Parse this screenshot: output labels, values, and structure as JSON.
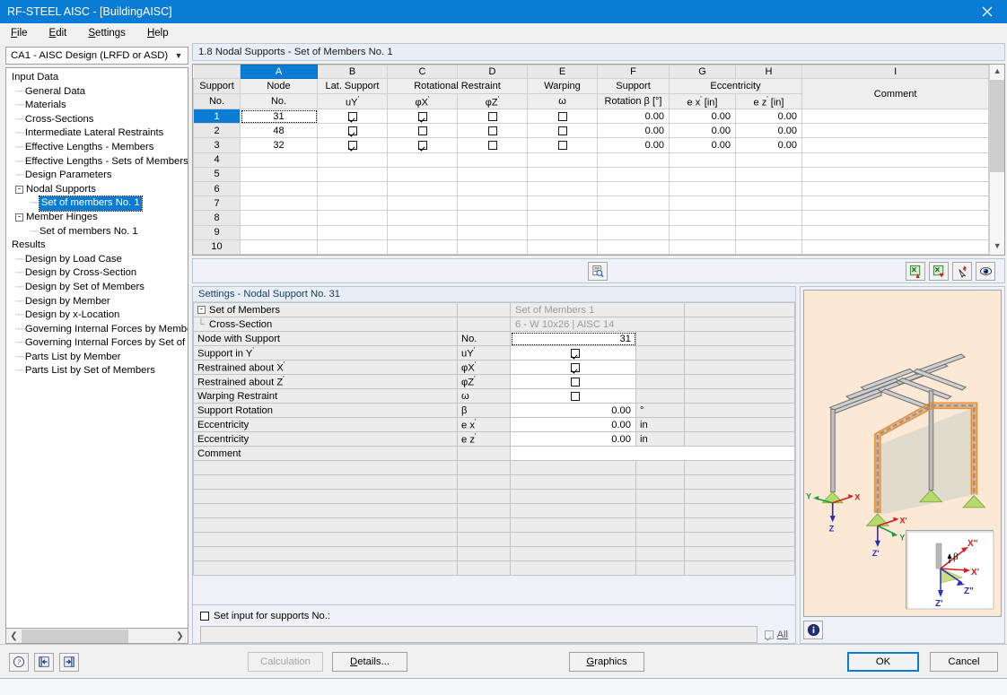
{
  "window": {
    "title": "RF-STEEL AISC - [BuildingAISC]",
    "close_icon": "close-icon"
  },
  "menu": [
    {
      "label": "File",
      "accel": "F"
    },
    {
      "label": "Edit",
      "accel": "E"
    },
    {
      "label": "Settings",
      "accel": "S"
    },
    {
      "label": "Help",
      "accel": "H"
    }
  ],
  "sidebar": {
    "combo_value": "CA1 - AISC Design (LRFD or ASD)",
    "nodes": [
      {
        "label": "Input Data",
        "level": 0,
        "expander": "",
        "selected": false
      },
      {
        "label": "General Data",
        "level": 1,
        "expander": "",
        "selected": false
      },
      {
        "label": "Materials",
        "level": 1,
        "expander": "",
        "selected": false
      },
      {
        "label": "Cross-Sections",
        "level": 1,
        "expander": "",
        "selected": false
      },
      {
        "label": "Intermediate Lateral Restraints",
        "level": 1,
        "expander": "",
        "selected": false
      },
      {
        "label": "Effective Lengths - Members",
        "level": 1,
        "expander": "",
        "selected": false
      },
      {
        "label": "Effective Lengths - Sets of Members",
        "level": 1,
        "expander": "",
        "selected": false
      },
      {
        "label": "Design Parameters",
        "level": 1,
        "expander": "",
        "selected": false
      },
      {
        "label": "Nodal Supports",
        "level": 1,
        "expander": "-",
        "selected": false
      },
      {
        "label": "Set of members No. 1",
        "level": 2,
        "expander": "",
        "selected": true
      },
      {
        "label": "Member Hinges",
        "level": 1,
        "expander": "-",
        "selected": false
      },
      {
        "label": "Set of members No. 1",
        "level": 2,
        "expander": "",
        "selected": false
      },
      {
        "label": "Results",
        "level": 0,
        "expander": "",
        "selected": false
      },
      {
        "label": "Design by Load Case",
        "level": 1,
        "expander": "",
        "selected": false
      },
      {
        "label": "Design by Cross-Section",
        "level": 1,
        "expander": "",
        "selected": false
      },
      {
        "label": "Design by Set of Members",
        "level": 1,
        "expander": "",
        "selected": false
      },
      {
        "label": "Design by Member",
        "level": 1,
        "expander": "",
        "selected": false
      },
      {
        "label": "Design by x-Location",
        "level": 1,
        "expander": "",
        "selected": false
      },
      {
        "label": "Governing Internal Forces by Member",
        "level": 1,
        "expander": "",
        "selected": false
      },
      {
        "label": "Governing Internal Forces by Set of M",
        "level": 1,
        "expander": "",
        "selected": false
      },
      {
        "label": "Parts List by Member",
        "level": 1,
        "expander": "",
        "selected": false
      },
      {
        "label": "Parts List by Set of Members",
        "level": 1,
        "expander": "",
        "selected": false
      }
    ]
  },
  "panel": {
    "title": "1.8 Nodal Supports - Set of Members No. 1"
  },
  "table": {
    "column_letters": [
      "",
      "A",
      "B",
      "C",
      "D",
      "E",
      "F",
      "G",
      "H",
      "I"
    ],
    "selected_letter": "A",
    "headers": [
      {
        "top": "Support",
        "bottom": "No.",
        "sym": ""
      },
      {
        "top": "Node",
        "bottom": "No.",
        "sym": ""
      },
      {
        "top": "Lat. Support",
        "bottom": "",
        "sym": "uY'"
      },
      {
        "top": "Rotational Restraint",
        "bottom": "",
        "sym": "φX'"
      },
      {
        "top": "",
        "bottom": "",
        "sym": "φZ'"
      },
      {
        "top": "Warping",
        "bottom": "",
        "sym": "ω"
      },
      {
        "top": "Support",
        "bottom": "Rotation β [°]",
        "sym": ""
      },
      {
        "top": "Eccentricity",
        "bottom": "e x' [in]",
        "sym": ""
      },
      {
        "top": "",
        "bottom": "e z' [in]",
        "sym": ""
      },
      {
        "top": "Comment",
        "bottom": "",
        "sym": ""
      }
    ],
    "rows": [
      {
        "no": "1",
        "node": "31",
        "lat": true,
        "rx": true,
        "rz": false,
        "warp": false,
        "beta": "0.00",
        "ex": "0.00",
        "ez": "0.00",
        "comment": "",
        "selected": true
      },
      {
        "no": "2",
        "node": "48",
        "lat": true,
        "rx": false,
        "rz": false,
        "warp": false,
        "beta": "0.00",
        "ex": "0.00",
        "ez": "0.00",
        "comment": "",
        "selected": false
      },
      {
        "no": "3",
        "node": "32",
        "lat": true,
        "rx": true,
        "rz": false,
        "warp": false,
        "beta": "0.00",
        "ex": "0.00",
        "ez": "0.00",
        "comment": "",
        "selected": false
      },
      {
        "no": "4",
        "node": "",
        "lat": null,
        "rx": null,
        "rz": null,
        "warp": null,
        "beta": "",
        "ex": "",
        "ez": "",
        "comment": "",
        "selected": false
      },
      {
        "no": "5",
        "node": "",
        "lat": null,
        "rx": null,
        "rz": null,
        "warp": null,
        "beta": "",
        "ex": "",
        "ez": "",
        "comment": "",
        "selected": false
      },
      {
        "no": "6",
        "node": "",
        "lat": null,
        "rx": null,
        "rz": null,
        "warp": null,
        "beta": "",
        "ex": "",
        "ez": "",
        "comment": "",
        "selected": false
      },
      {
        "no": "7",
        "node": "",
        "lat": null,
        "rx": null,
        "rz": null,
        "warp": null,
        "beta": "",
        "ex": "",
        "ez": "",
        "comment": "",
        "selected": false
      },
      {
        "no": "8",
        "node": "",
        "lat": null,
        "rx": null,
        "rz": null,
        "warp": null,
        "beta": "",
        "ex": "",
        "ez": "",
        "comment": "",
        "selected": false
      },
      {
        "no": "9",
        "node": "",
        "lat": null,
        "rx": null,
        "rz": null,
        "warp": null,
        "beta": "",
        "ex": "",
        "ez": "",
        "comment": "",
        "selected": false
      },
      {
        "no": "10",
        "node": "",
        "lat": null,
        "rx": null,
        "rz": null,
        "warp": null,
        "beta": "",
        "ex": "",
        "ez": "",
        "comment": "",
        "selected": false
      }
    ]
  },
  "midtoolbar": {
    "view_icon": "document-search-icon",
    "import_excel_icon": "excel-import-icon",
    "export_excel_icon": "excel-export-icon",
    "pick_icon": "pick-pointer-icon",
    "visibility_icon": "eye-icon"
  },
  "settings": {
    "title": "Settings - Nodal Support No. 31",
    "rows": [
      {
        "name": "Set of Members",
        "sym": "",
        "value": "Set of Members 1",
        "unit": "",
        "kind": "gray",
        "indent": 0,
        "expander": "-"
      },
      {
        "name": "Cross-Section",
        "sym": "",
        "value": "6 - W 10x26 | AISC 14",
        "unit": "",
        "kind": "gray",
        "indent": 1,
        "elbow": true
      },
      {
        "name": "Node with Support",
        "sym": "No.",
        "value": "31",
        "unit": "",
        "kind": "num-focus",
        "indent": 1
      },
      {
        "name": "Support in Y'",
        "sym": "uY'",
        "value": true,
        "unit": "",
        "kind": "check",
        "indent": 1
      },
      {
        "name": "Restrained about X'",
        "sym": "φX'",
        "value": true,
        "unit": "",
        "kind": "check",
        "indent": 1
      },
      {
        "name": "Restrained about Z'",
        "sym": "φZ'",
        "value": false,
        "unit": "",
        "kind": "check",
        "indent": 1
      },
      {
        "name": "Warping Restraint",
        "sym": "ω",
        "value": false,
        "unit": "",
        "kind": "check",
        "indent": 1
      },
      {
        "name": "Support Rotation",
        "sym": "β",
        "value": "0.00",
        "unit": "°",
        "kind": "num",
        "indent": 1
      },
      {
        "name": "Eccentricity",
        "sym": "e x'",
        "value": "0.00",
        "unit": "in",
        "kind": "num",
        "indent": 1
      },
      {
        "name": "Eccentricity",
        "sym": "e z'",
        "value": "0.00",
        "unit": "in",
        "kind": "num",
        "indent": 1
      },
      {
        "name": "Comment",
        "sym": "",
        "value": "",
        "unit": "",
        "kind": "text",
        "indent": 1
      }
    ],
    "empty_row_count": 8,
    "footer": {
      "set_input_label": "Set input for supports No.:",
      "set_input_checked": false,
      "input_value": "",
      "all_label": "All",
      "all_checked": true,
      "all_disabled": true
    }
  },
  "view3d": {
    "axes_global": {
      "x": "X",
      "y": "Y",
      "z": "Z"
    },
    "axes_local": {
      "x": "X'",
      "y": "Y'",
      "z": "Z'"
    },
    "inset": {
      "x2": "X\"",
      "x1": "X'",
      "z2": "Z\"",
      "z1": "Z'",
      "beta": "β"
    },
    "info_icon": "info-icon",
    "highlight_color": "#ef8b2c",
    "background_color": "#fbe9d6"
  },
  "bottombar": {
    "help_icon": "help-icon",
    "prev_icon": "previous-icon",
    "next_icon": "next-icon",
    "calculation_label": "Calculation",
    "calculation_disabled": true,
    "details_label": "Details...",
    "graphics_label": "Graphics",
    "ok_label": "OK",
    "cancel_label": "Cancel"
  }
}
